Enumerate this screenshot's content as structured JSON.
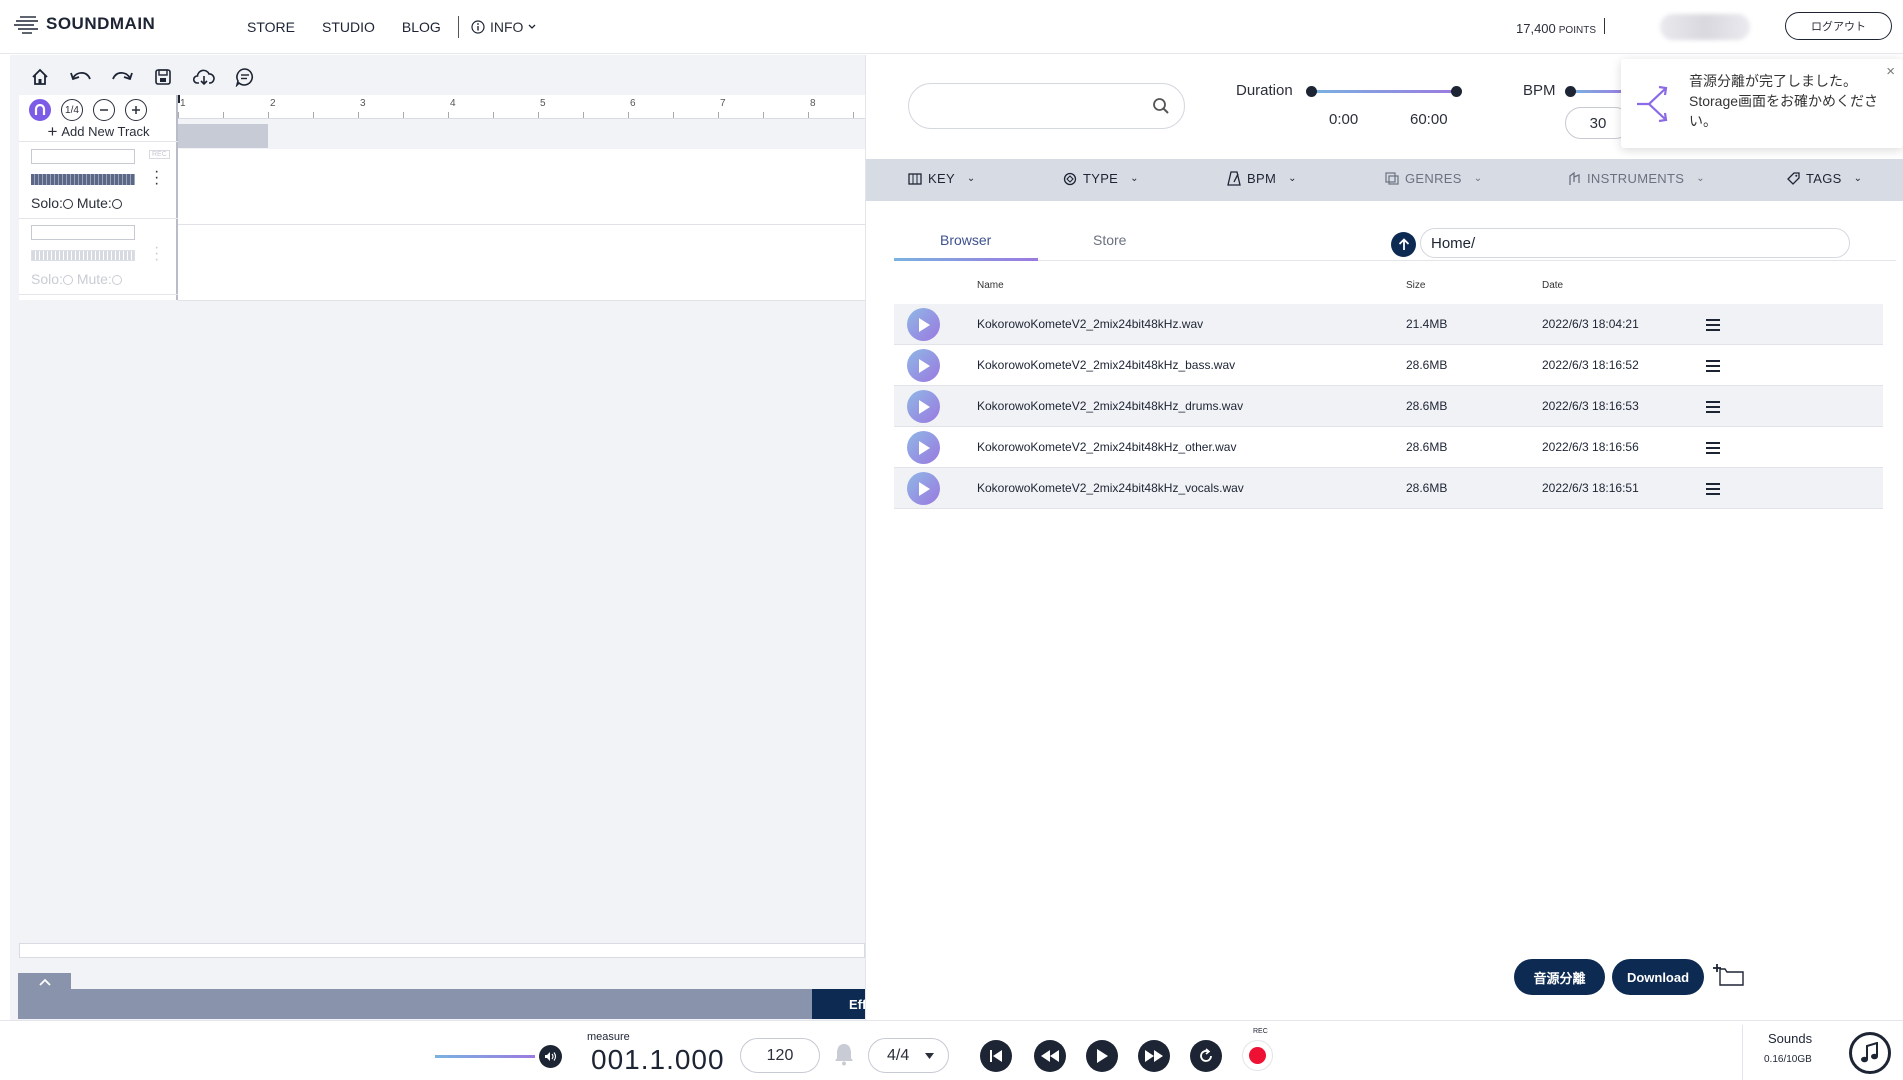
{
  "nav": {
    "logo": "SOUNDMAIN",
    "links": [
      "STORE",
      "STUDIO",
      "BLOG"
    ],
    "info": "INFO",
    "points_value": "17,400",
    "points_unit": "POINTS",
    "logout": "ログアウト"
  },
  "studio": {
    "toolbar_icons": [
      "home-icon",
      "undo-icon",
      "redo-icon",
      "save-icon",
      "cloud-download-icon",
      "comment-icon"
    ],
    "snap_value": "1/4",
    "add_track": "Add New Track",
    "ruler": [
      "1",
      "2",
      "3",
      "4",
      "5",
      "6",
      "7",
      "8"
    ],
    "tracks": [
      {
        "rec": "REC",
        "solo": "Solo:",
        "mute": "Mute:"
      },
      {
        "rec": "",
        "solo": "Solo:",
        "mute": "Mute:"
      }
    ],
    "effects_label": "Effects"
  },
  "browser": {
    "search_placeholder": "",
    "duration": {
      "label": "Duration",
      "min": "0:00",
      "max": "60:00"
    },
    "bpm": {
      "label": "BPM",
      "min": "30"
    },
    "filters": [
      "KEY",
      "TYPE",
      "BPM",
      "GENRES",
      "INSTRUMENTS",
      "TAGS"
    ],
    "tabs": [
      "Browser",
      "Store"
    ],
    "active_tab": "Browser",
    "path": "Home/",
    "columns": {
      "name": "Name",
      "size": "Size",
      "date": "Date"
    },
    "files": [
      {
        "name": "KokorowoKometeV2_2mix24bit48kHz.wav",
        "size": "21.4MB",
        "date": "2022/6/3 18:04:21"
      },
      {
        "name": "KokorowoKometeV2_2mix24bit48kHz_bass.wav",
        "size": "28.6MB",
        "date": "2022/6/3 18:16:52"
      },
      {
        "name": "KokorowoKometeV2_2mix24bit48kHz_drums.wav",
        "size": "28.6MB",
        "date": "2022/6/3 18:16:53"
      },
      {
        "name": "KokorowoKometeV2_2mix24bit48kHz_other.wav",
        "size": "28.6MB",
        "date": "2022/6/3 18:16:56"
      },
      {
        "name": "KokorowoKometeV2_2mix24bit48kHz_vocals.wav",
        "size": "28.6MB",
        "date": "2022/6/3 18:16:51"
      }
    ],
    "separate_button": "音源分離",
    "download_button": "Download"
  },
  "toast": {
    "message": "音源分離が完了しました。Storage画面をお確かめください。"
  },
  "transport": {
    "measure_label": "measure",
    "measure_value": "001.1.000",
    "tempo": "120",
    "time_signature": "4/4",
    "rec_label": "REC",
    "sounds_label": "Sounds",
    "sounds_usage": "0.16/10GB"
  },
  "colors": {
    "navy": "#0d2a52",
    "accent": "#9b7ae0",
    "record": "#ee1133"
  }
}
